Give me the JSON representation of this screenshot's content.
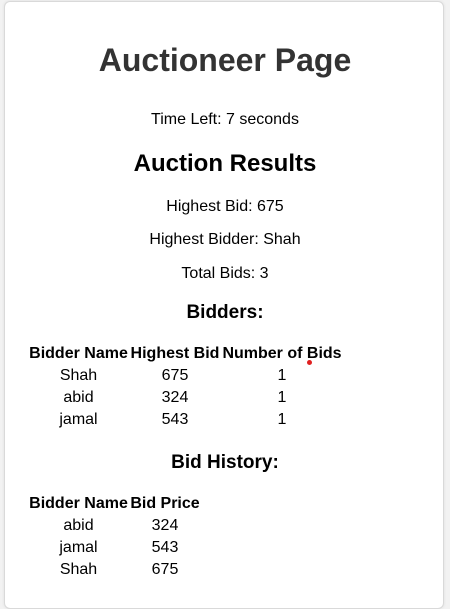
{
  "page": {
    "title": "Auctioneer Page",
    "time_left": "Time Left: 7 seconds"
  },
  "results": {
    "title": "Auction Results",
    "highest_bid": "Highest Bid: 675",
    "highest_bidder": "Highest Bidder: Shah",
    "total_bids": "Total Bids: 3"
  },
  "bidders": {
    "title": "Bidders:",
    "headers": [
      "Bidder Name",
      "Highest Bid",
      "Number of Bids"
    ],
    "rows": [
      [
        "Shah",
        "675",
        "1"
      ],
      [
        "abid",
        "324",
        "1"
      ],
      [
        "jamal",
        "543",
        "1"
      ]
    ]
  },
  "history": {
    "title": "Bid History:",
    "headers": [
      "Bidder Name",
      "Bid Price"
    ],
    "rows": [
      [
        "abid",
        "324"
      ],
      [
        "jamal",
        "543"
      ],
      [
        "Shah",
        "675"
      ]
    ]
  },
  "colors": {
    "page_background": "#f2f2f2",
    "card_background": "#ffffff",
    "title_color": "#333333",
    "cursor_dot": "#e02020"
  }
}
